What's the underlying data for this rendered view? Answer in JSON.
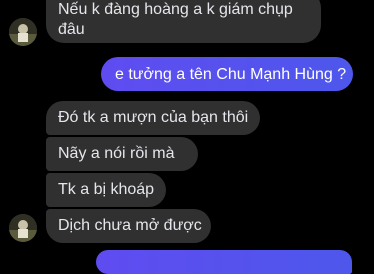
{
  "conversation": {
    "messages": [
      {
        "sender": "contact",
        "text_line1": "Nếu k đàng hoàng a k giám chụp",
        "text_line2": "đâu"
      },
      {
        "sender": "me",
        "text": "e tưởng a tên Chu Mạnh Hùng ?"
      },
      {
        "sender": "contact",
        "text": "Đó tk a mượn của bạn thôi"
      },
      {
        "sender": "contact",
        "text": "Nãy a nói rồi mà"
      },
      {
        "sender": "contact",
        "text": "Tk a bị khoáp"
      },
      {
        "sender": "contact",
        "text": "Dịch chưa mở được"
      }
    ]
  },
  "colors": {
    "background": "#000000",
    "incoming_bubble": "#303030",
    "outgoing_bubble": "#5b4dee",
    "text_incoming": "#e4e6eb",
    "text_outgoing": "#ffffff"
  },
  "icons": {
    "contact_avatar": "contact-avatar"
  }
}
